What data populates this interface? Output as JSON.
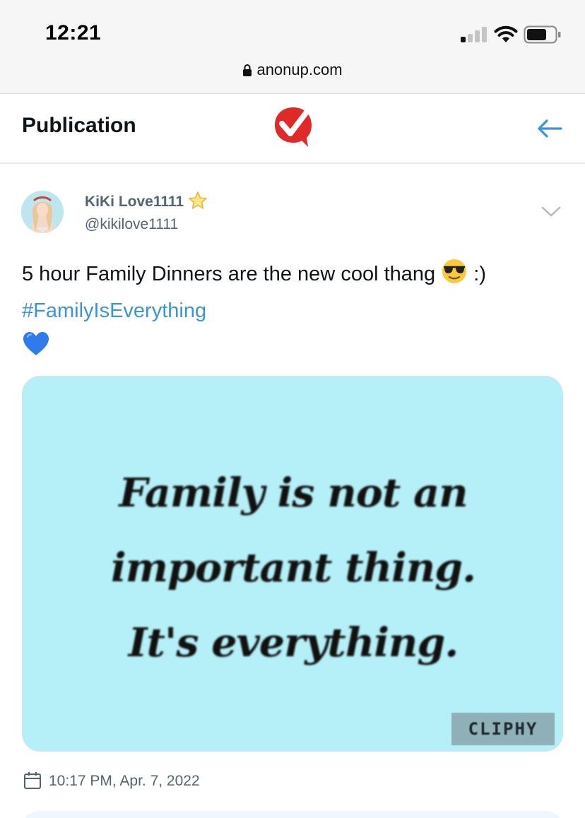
{
  "status_bar": {
    "time": "12:21",
    "signal_bars_on": 1,
    "signal_bars_total": 4
  },
  "browser": {
    "url": "anonup.com"
  },
  "header": {
    "title": "Publication",
    "logo_icon": "anonup-check-logo-icon",
    "back_icon": "arrow-left-icon",
    "accent": "#3b94d9",
    "logo_color": "#e02a2a"
  },
  "post": {
    "display_name": "KiKi Love1111",
    "handle": "@kikilove1111",
    "text_line1": "5 hour Family Dinners are the new cool thang",
    "text_suffix": ":)",
    "hashtag": "#FamilyIsEverything",
    "emoji_sunglasses": "sunglasses-face-icon",
    "emoji_heart": "blue-heart-icon",
    "media": {
      "line1": "Family is not an",
      "line2": "important thing.",
      "line3": "It's everything.",
      "watermark": "CLIPHY",
      "background": "#b5f0f8"
    },
    "timestamp": "10:17 PM, Apr. 7, 2022"
  }
}
